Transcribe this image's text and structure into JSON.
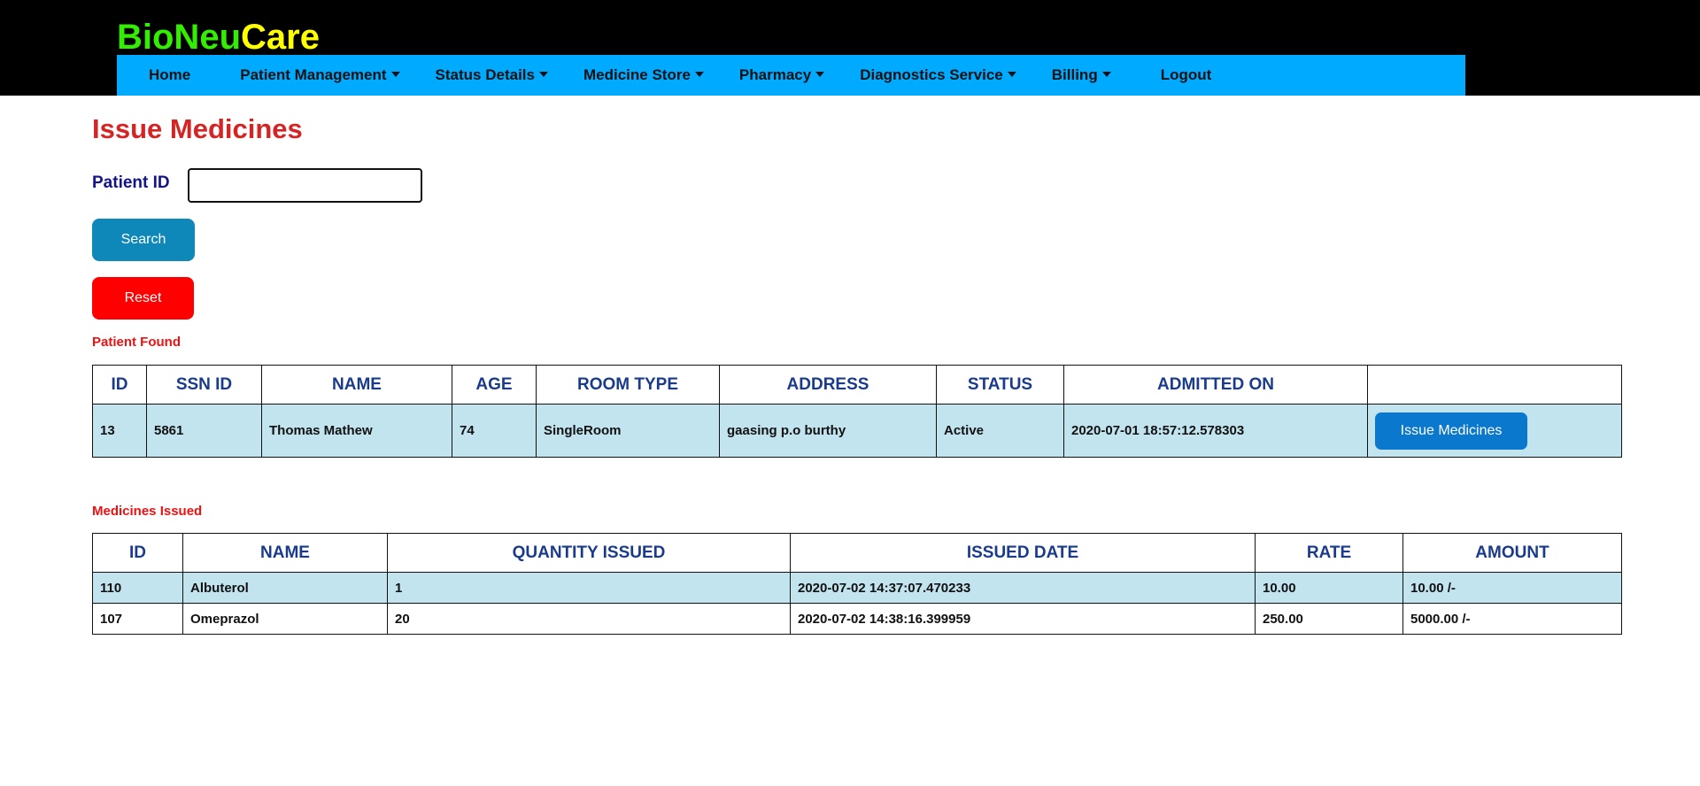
{
  "brand": {
    "part1": "BioNeu",
    "part2": "Care"
  },
  "nav": [
    {
      "label": "Home",
      "dropdown": false
    },
    {
      "label": "Patient Management",
      "dropdown": true
    },
    {
      "label": "Status Details",
      "dropdown": true
    },
    {
      "label": "Medicine Store",
      "dropdown": true
    },
    {
      "label": "Pharmacy",
      "dropdown": true
    },
    {
      "label": "Diagnostics Service",
      "dropdown": true
    },
    {
      "label": "Billing",
      "dropdown": true
    },
    {
      "label": "Logout",
      "dropdown": false
    }
  ],
  "page": {
    "title": "Issue Medicines",
    "patient_id_label": "Patient ID",
    "patient_id_value": "",
    "search_label": "Search",
    "reset_label": "Reset"
  },
  "patient_section": {
    "label": "Patient Found",
    "headers": [
      "ID",
      "SSN ID",
      "NAME",
      "AGE",
      "ROOM TYPE",
      "ADDRESS",
      "STATUS",
      "ADMITTED ON",
      ""
    ],
    "row": {
      "id": "13",
      "ssn_id": "5861",
      "name": "Thomas Mathew",
      "age": "74",
      "room_type": "SingleRoom",
      "address": "gaasing p.o burthy",
      "status": "Active",
      "admitted_on": "2020-07-01 18:57:12.578303",
      "action_label": "Issue Medicines"
    }
  },
  "medicines_section": {
    "label": "Medicines Issued",
    "headers": [
      "ID",
      "NAME",
      "QUANTITY ISSUED",
      "ISSUED DATE",
      "RATE",
      "AMOUNT"
    ],
    "rows": [
      {
        "id": "110",
        "name": "Albuterol",
        "quantity": "1",
        "issued_date": "2020-07-02 14:37:07.470233",
        "rate": "10.00",
        "amount": "10.00 /-"
      },
      {
        "id": "107",
        "name": "Omeprazol",
        "quantity": "20",
        "issued_date": "2020-07-02 14:38:16.399959",
        "rate": "250.00",
        "amount": "5000.00 /-"
      }
    ]
  },
  "colors": {
    "brand_green": "#33ee00",
    "brand_yellow": "#ffff00",
    "nav_bg": "#00aaff",
    "title_red": "#d42424",
    "search_btn": "#0e88b8",
    "reset_btn": "#ff0000",
    "issue_btn": "#0a78cc",
    "row_highlight": "#c2e4ee"
  }
}
